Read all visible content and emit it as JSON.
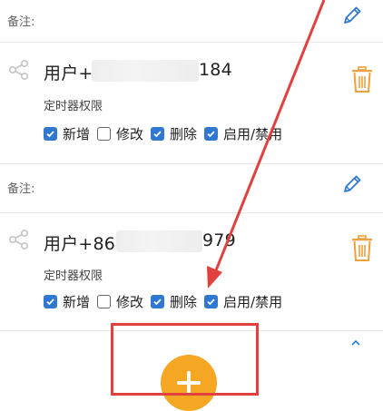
{
  "colors": {
    "accent_blue": "#2f78d0",
    "trash_orange": "#f0a03c",
    "fab_orange": "#f5a623",
    "annotation_red": "#e0413f"
  },
  "entries": [
    {
      "note_label": "备注:",
      "user_prefix": "用户+",
      "user_suffix": "184",
      "perm_title": "定时器权限",
      "perms": [
        {
          "label": "新增",
          "checked": true
        },
        {
          "label": "修改",
          "checked": false
        },
        {
          "label": "删除",
          "checked": true
        },
        {
          "label": "启用/禁用",
          "checked": true
        }
      ]
    },
    {
      "note_label": "备注:",
      "user_prefix": "用户+86",
      "user_suffix": "979",
      "perm_title": "定时器权限",
      "perms": [
        {
          "label": "新增",
          "checked": true
        },
        {
          "label": "修改",
          "checked": false
        },
        {
          "label": "删除",
          "checked": true
        },
        {
          "label": "启用/禁用",
          "checked": true
        }
      ]
    }
  ],
  "icons": {
    "edit": "pencil-icon",
    "share": "share-icon",
    "delete": "trash-icon",
    "add": "plus-icon",
    "collapse": "chevron-up-icon"
  }
}
